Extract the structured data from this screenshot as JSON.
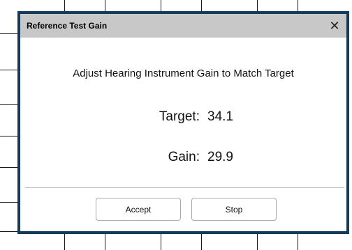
{
  "dialog": {
    "title": "Reference Test Gain",
    "close_icon": "close-icon",
    "close_glyph": "✕",
    "instruction": "Adjust Hearing Instrument Gain to Match Target",
    "target": {
      "label": "Target:",
      "value": "34.1"
    },
    "gain": {
      "label": "Gain:",
      "value": "29.9"
    },
    "buttons": {
      "accept_label": "Accept",
      "stop_label": "Stop"
    }
  },
  "colors": {
    "dialog_border": "#163a5c",
    "titlebar_bg": "#c8c8c8",
    "background": "#ffffff"
  }
}
